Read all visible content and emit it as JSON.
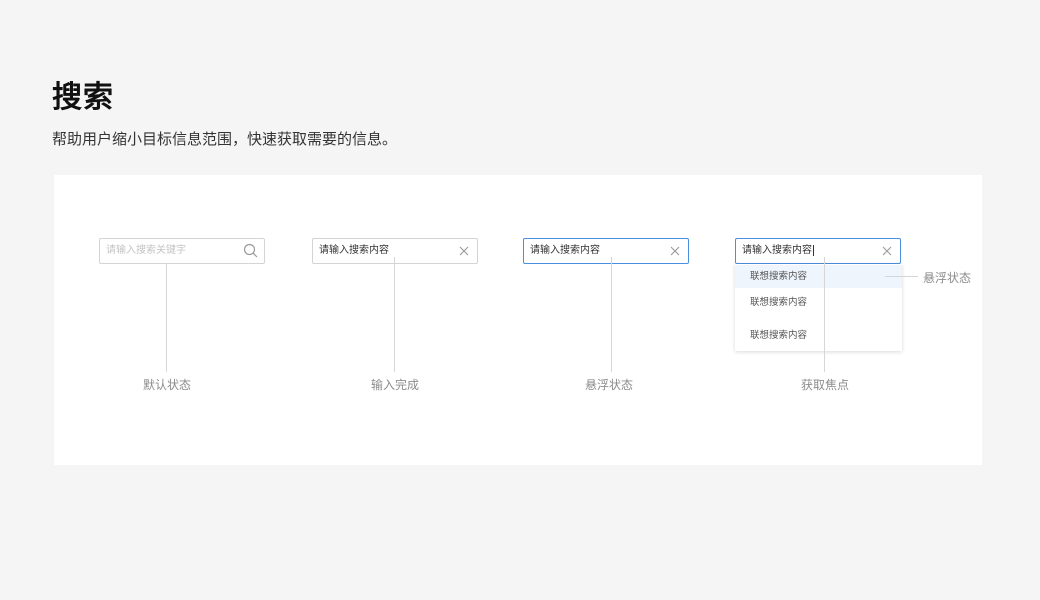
{
  "header": {
    "title": "搜索",
    "description": "帮助用户缩小目标信息范围，快速获取需要的信息。"
  },
  "states": [
    {
      "kind": "default",
      "placeholder": "请输入搜索关键字",
      "icon": "search-icon",
      "caption": "默认状态"
    },
    {
      "kind": "filled",
      "value": "请输入搜索内容",
      "icon": "close-icon",
      "caption": "输入完成"
    },
    {
      "kind": "hover",
      "value": "请输入搜索内容",
      "icon": "close-icon",
      "caption": "悬浮状态"
    },
    {
      "kind": "focus",
      "value": "请输入搜索内容",
      "icon": "close-icon",
      "caption": "获取焦点"
    }
  ],
  "dropdown": {
    "items": [
      "联想搜索内容",
      "联想搜索内容",
      "联想搜索内容"
    ],
    "hover_caption": "悬浮状态"
  },
  "colors": {
    "background": "#f5f5f5",
    "panel": "#ffffff",
    "border": "#d4d4d4",
    "focus_border": "#4a90e2",
    "hover_item": "#eef5fd",
    "caption": "#8c8c8c"
  }
}
